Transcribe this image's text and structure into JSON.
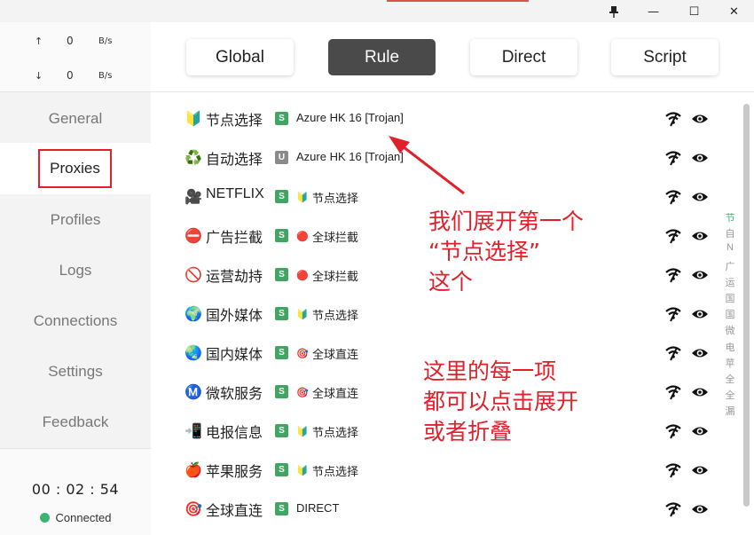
{
  "window": {
    "pin_icon": "pin-icon",
    "minimize_glyph": "—",
    "maximize_glyph": "☐",
    "close_glyph": "✕"
  },
  "traffic": {
    "up_arrow": "↑",
    "up_value": "0",
    "up_unit": "B/s",
    "down_arrow": "↓",
    "down_value": "0",
    "down_unit": "B/s"
  },
  "nav": {
    "general": "General",
    "proxies": "Proxies",
    "profiles": "Profiles",
    "logs": "Logs",
    "connections": "Connections",
    "settings": "Settings",
    "feedback": "Feedback"
  },
  "footer": {
    "timer": "00 : 02 : 54",
    "status": "Connected"
  },
  "modes": {
    "global": "Global",
    "rule": "Rule",
    "direct": "Direct",
    "script": "Script",
    "active": "Rule"
  },
  "groups": [
    {
      "icon": "🔰",
      "name": "节点选择",
      "badge": "S",
      "selected_icon": "",
      "selected": "Azure HK 16 [Trojan]"
    },
    {
      "icon": "♻️",
      "name": "自动选择",
      "badge": "U",
      "selected_icon": "",
      "selected": "Azure HK 16 [Trojan]"
    },
    {
      "icon": "🎥",
      "name": "NETFLIX",
      "badge": "S",
      "selected_icon": "🔰",
      "selected": "节点选择"
    },
    {
      "icon": "⛔",
      "name": "广告拦截",
      "badge": "S",
      "selected_icon": "🔴",
      "selected": "全球拦截"
    },
    {
      "icon": "🚫",
      "name": "运营劫持",
      "badge": "S",
      "selected_icon": "🔴",
      "selected": "全球拦截"
    },
    {
      "icon": "🌍",
      "name": "国外媒体",
      "badge": "S",
      "selected_icon": "🔰",
      "selected": "节点选择"
    },
    {
      "icon": "🌏",
      "name": "国内媒体",
      "badge": "S",
      "selected_icon": "🎯",
      "selected": "全球直连"
    },
    {
      "icon": "Ⓜ️",
      "name": "微软服务",
      "badge": "S",
      "selected_icon": "🎯",
      "selected": "全球直连"
    },
    {
      "icon": "📲",
      "name": "电报信息",
      "badge": "S",
      "selected_icon": "🔰",
      "selected": "节点选择"
    },
    {
      "icon": "🍎",
      "name": "苹果服务",
      "badge": "S",
      "selected_icon": "🔰",
      "selected": "节点选择"
    },
    {
      "icon": "🎯",
      "name": "全球直连",
      "badge": "S",
      "selected_icon": "",
      "selected": "DIRECT"
    }
  ],
  "index_letters": [
    "节",
    "自",
    "N",
    "广",
    "运",
    "国",
    "国",
    "微",
    "电",
    "苹",
    "全",
    "全",
    "漏"
  ],
  "annotations": {
    "top_line1": "我们展开第一个",
    "top_line2": "“节点选择”",
    "top_line3": "这个",
    "bottom_line1": "这里的每一项",
    "bottom_line2": "都可以点击展开",
    "bottom_line3": "或者折叠"
  },
  "colors": {
    "accent_dark": "#4a4a4a",
    "connected": "#3cb371",
    "badge_s": "#43a564",
    "badge_u": "#8a8a8a",
    "annotation": "#e0202a"
  }
}
